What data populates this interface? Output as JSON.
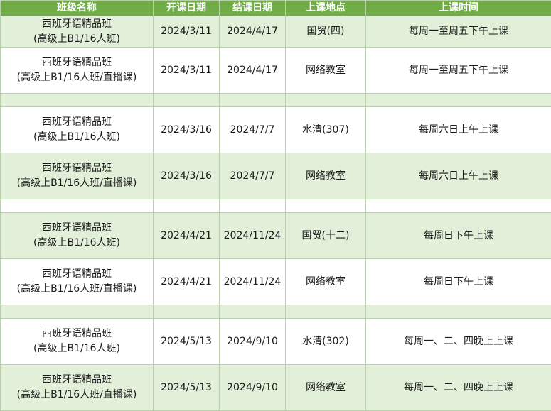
{
  "headers": [
    "班级名称",
    "开课日期",
    "结课日期",
    "上课地点",
    "上课时间"
  ],
  "rows": [
    {
      "kind": "data",
      "fill": "green",
      "first": true,
      "name1": "西班牙语精品班",
      "name2": "(高级上B1/16人班)",
      "start": "2024/3/11",
      "end": "2024/4/17",
      "place": "国贸(四)",
      "time": "每周一至周五下午上课"
    },
    {
      "kind": "data",
      "fill": "white",
      "name1": "西班牙语精品班",
      "name2": "(高级上B1/16人班/直播课)",
      "start": "2024/3/11",
      "end": "2024/4/17",
      "place": "网络教室",
      "time": "每周一至周五下午上课"
    },
    {
      "kind": "gap",
      "fill": "green"
    },
    {
      "kind": "data",
      "fill": "white",
      "name1": "西班牙语精品班",
      "name2": "(高级上B1/16人班)",
      "start": "2024/3/16",
      "end": "2024/7/7",
      "place": "水清(307)",
      "time": "每周六日上午上课"
    },
    {
      "kind": "data",
      "fill": "green",
      "name1": "西班牙语精品班",
      "name2": "(高级上B1/16人班/直播课)",
      "start": "2024/3/16",
      "end": "2024/7/7",
      "place": "网络教室",
      "time": "每周六日上午上课"
    },
    {
      "kind": "gap",
      "fill": "white"
    },
    {
      "kind": "data",
      "fill": "green",
      "name1": "西班牙语精品班",
      "name2": "(高级上B1/16人班)",
      "start": "2024/4/21",
      "end": "2024/11/24",
      "place": "国贸(十二)",
      "time": "每周日下午上课"
    },
    {
      "kind": "data",
      "fill": "white",
      "name1": "西班牙语精品班",
      "name2": "(高级上B1/16人班/直播课)",
      "start": "2024/4/21",
      "end": "2024/11/24",
      "place": "网络教室",
      "time": "每周日下午上课"
    },
    {
      "kind": "gap",
      "fill": "green"
    },
    {
      "kind": "data",
      "fill": "white",
      "name1": "西班牙语精品班",
      "name2": "(高级上B1/16人班)",
      "start": "2024/5/13",
      "end": "2024/9/10",
      "place": "水清(302)",
      "time": "每周一、二、四晚上上课"
    },
    {
      "kind": "data",
      "fill": "green",
      "name1": "西班牙语精品班",
      "name2": "(高级上B1/16人班/直播课)",
      "start": "2024/5/13",
      "end": "2024/9/10",
      "place": "网络教室",
      "time": "每周一、二、四晚上上课"
    }
  ]
}
